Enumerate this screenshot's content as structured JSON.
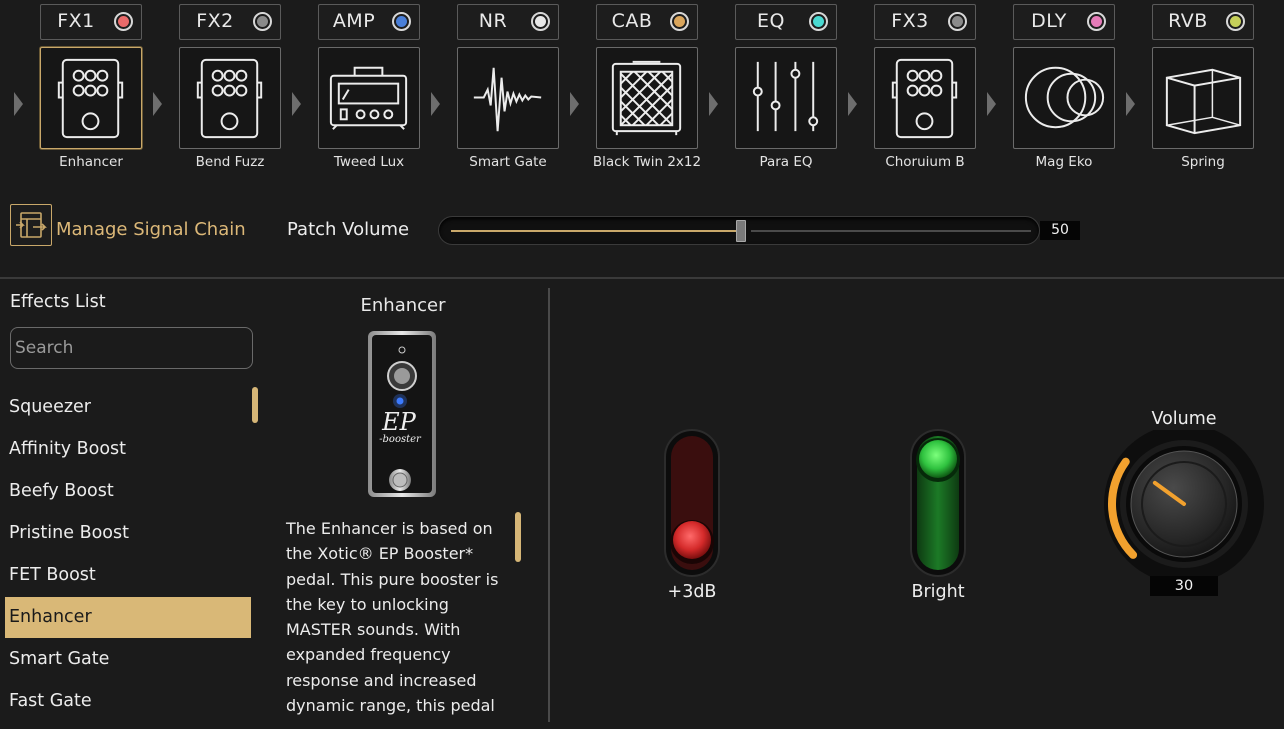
{
  "signal_chain": [
    {
      "slot": "FX1",
      "effect": "Enhancer",
      "led_color": "#e96a6a",
      "icon": "pedal-icon",
      "active": true
    },
    {
      "slot": "FX2",
      "effect": "Bend Fuzz",
      "led_color": "#8a8a8a",
      "icon": "pedal-icon",
      "active": false
    },
    {
      "slot": "AMP",
      "effect": "Tweed Lux",
      "led_color": "#4a7fd8",
      "icon": "amp-head-icon",
      "active": false
    },
    {
      "slot": "NR",
      "effect": "Smart Gate",
      "led_color": "#e8e8e8",
      "icon": "noise-gate-icon",
      "active": false
    },
    {
      "slot": "CAB",
      "effect": "Black Twin 2x12",
      "led_color": "#d9a55c",
      "icon": "cabinet-icon",
      "active": false
    },
    {
      "slot": "EQ",
      "effect": "Para EQ",
      "led_color": "#4ad9d1",
      "icon": "eq-sliders-icon",
      "active": false
    },
    {
      "slot": "FX3",
      "effect": "Choruium B",
      "led_color": "#8a8a8a",
      "icon": "pedal-icon",
      "active": false
    },
    {
      "slot": "DLY",
      "effect": "Mag Eko",
      "led_color": "#e57bb8",
      "icon": "delay-circles-icon",
      "active": false
    },
    {
      "slot": "RVB",
      "effect": "Spring",
      "led_color": "#c6d05a",
      "icon": "reverb-cube-icon",
      "active": false
    }
  ],
  "chain_controls": {
    "manage_label": "Manage Signal Chain",
    "manage_icon": "signal-chain-icon",
    "patch_volume_label": "Patch Volume",
    "patch_volume": 50,
    "patch_volume_display": "50"
  },
  "effects_list": {
    "title": "Effects List",
    "search_placeholder": "Search",
    "items": [
      "Squeezer",
      "Affinity Boost",
      "Beefy Boost",
      "Pristine Boost",
      "FET Boost",
      "Enhancer",
      "Smart Gate",
      "Fast Gate"
    ],
    "selected": "Enhancer"
  },
  "effect_detail": {
    "title": "Enhancer",
    "description": "The Enhancer is based on the Xotic® EP Booster* pedal. This pure booster is the key to unlocking MASTER sounds. With expanded frequency response and increased dynamic range, this pedal"
  },
  "parameters": {
    "boost": {
      "label": "+3dB",
      "state": "off",
      "color": "#d42a2a"
    },
    "bright": {
      "label": "Bright",
      "state": "on",
      "color": "#2fc23f"
    },
    "volume": {
      "label": "Volume",
      "value": 30,
      "value_display": "30",
      "accent": "#f2a12e"
    }
  },
  "colors": {
    "accent": "#d9b877",
    "background": "#1b1b1b"
  }
}
